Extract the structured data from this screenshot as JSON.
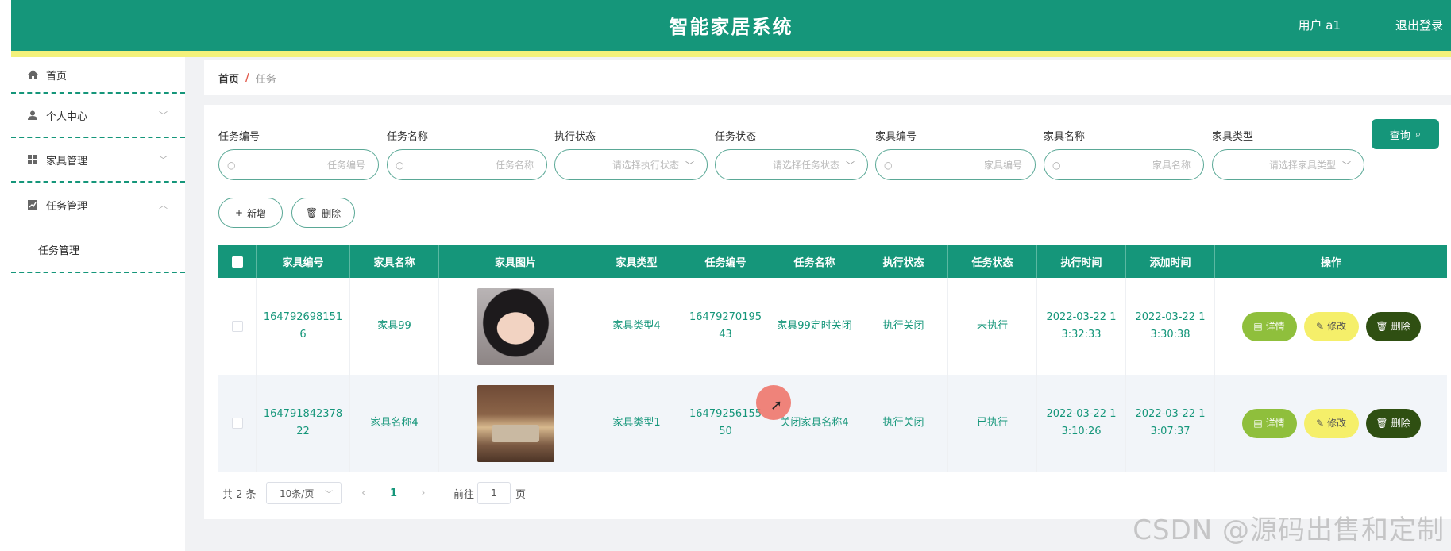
{
  "header": {
    "title": "智能家居系统",
    "user": "用户 a1",
    "logout": "退出登录",
    "bg_color": "#15967a",
    "stripe_color": "#f3f17a"
  },
  "sidebar": {
    "items": [
      {
        "label": "首页",
        "icon": "home-icon"
      },
      {
        "label": "个人中心",
        "icon": "user-icon"
      },
      {
        "label": "家具管理",
        "icon": "grid-icon"
      },
      {
        "label": "任务管理",
        "icon": "chart-icon",
        "children": [
          {
            "label": "任务管理"
          }
        ]
      }
    ]
  },
  "breadcrumb": {
    "home": "首页",
    "sep": "/",
    "current": "任务"
  },
  "filters": [
    {
      "label": "任务编号",
      "placeholder": "任务编号",
      "type": "input"
    },
    {
      "label": "任务名称",
      "placeholder": "任务名称",
      "type": "input"
    },
    {
      "label": "执行状态",
      "placeholder": "请选择执行状态",
      "type": "select"
    },
    {
      "label": "任务状态",
      "placeholder": "请选择任务状态",
      "type": "select"
    },
    {
      "label": "家具编号",
      "placeholder": "家具编号",
      "type": "input"
    },
    {
      "label": "家具名称",
      "placeholder": "家具名称",
      "type": "input"
    },
    {
      "label": "家具类型",
      "placeholder": "请选择家具类型",
      "type": "select"
    }
  ],
  "actions": {
    "query": "查询",
    "add": "新增",
    "delete": "删除"
  },
  "table": {
    "columns": [
      "家具编号",
      "家具名称",
      "家具图片",
      "家具类型",
      "任务编号",
      "任务名称",
      "执行状态",
      "任务状态",
      "执行时间",
      "添加时间",
      "操作"
    ],
    "rows": [
      {
        "furniture_no": "1647926981516",
        "furniture_name": "家具99",
        "image": "portrait-photo",
        "furniture_type": "家具类型4",
        "task_no": "1647927019543",
        "task_name": "家具99定时关闭",
        "exec_status": "执行关闭",
        "task_status": "未执行",
        "exec_time": "2022-03-22 13:32:33",
        "add_time": "2022-03-22 13:30:38"
      },
      {
        "furniture_no": "164791842378 22",
        "furniture_name": "家具名称4",
        "image": "living-room-photo",
        "furniture_type": "家具类型1",
        "task_no": "1647925615550",
        "task_name": "关闭家具名称4",
        "exec_status": "执行关闭",
        "task_status": "已执行",
        "exec_time": "2022-03-22 13:10:26",
        "add_time": "2022-03-22 13:07:37"
      }
    ],
    "ops": {
      "detail": "详情",
      "edit": "修改",
      "delete": "删除"
    }
  },
  "pagination": {
    "total": "共 2 条",
    "page_size": "10条/页",
    "current_page": "1",
    "goto_label": "前往",
    "goto_value": "1",
    "page_suffix": "页"
  },
  "watermark": "CSDN @源码出售和定制"
}
